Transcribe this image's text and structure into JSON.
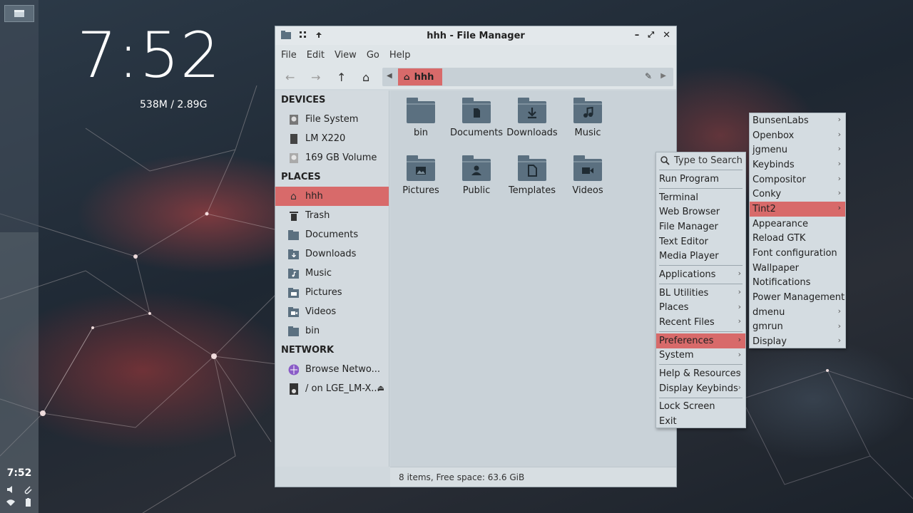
{
  "conky": {
    "time": "7:52",
    "memory": "538M / 2.89G"
  },
  "panel": {
    "clock": "7:52"
  },
  "window": {
    "title": "hhh - File Manager",
    "menu": [
      "File",
      "Edit",
      "View",
      "Go",
      "Help"
    ],
    "path": {
      "crumb": "hhh"
    },
    "sidebar": {
      "devices_heading": "DEVICES",
      "devices": [
        "File System",
        "LM X220",
        "169 GB Volume"
      ],
      "places_heading": "PLACES",
      "places": [
        "hhh",
        "Trash",
        "Documents",
        "Downloads",
        "Music",
        "Pictures",
        "Videos",
        "bin"
      ],
      "network_heading": "NETWORK",
      "network": [
        "Browse Netwo...",
        "/ on LGE_LM-X..."
      ]
    },
    "files": [
      "bin",
      "Documents",
      "Downloads",
      "Music",
      "Pictures",
      "Public",
      "Templates",
      "Videos"
    ],
    "status": "8 items, Free space: 63.6 GiB"
  },
  "rootmenu": {
    "search": "Type to Search",
    "run": "Run Program",
    "group1": [
      "Terminal",
      "Web Browser",
      "File Manager",
      "Text Editor",
      "Media Player"
    ],
    "applications": "Applications",
    "group2": [
      "BL Utilities",
      "Places",
      "Recent Files"
    ],
    "preferences": "Preferences",
    "system": "System",
    "group3": [
      "Help & Resources",
      "Display Keybinds"
    ],
    "lock": "Lock Screen",
    "exit": "Exit"
  },
  "submenu": {
    "items": [
      "BunsenLabs",
      "Openbox",
      "jgmenu",
      "Keybinds",
      "Compositor",
      "Conky",
      "Tint2",
      "Appearance",
      "Reload GTK",
      "Font configuration",
      "Wallpaper",
      "Notifications",
      "Power Management",
      "dmenu",
      "gmrun",
      "Display"
    ]
  },
  "colors": {
    "accent": "#d86a6a",
    "folder": "#5b7080"
  }
}
